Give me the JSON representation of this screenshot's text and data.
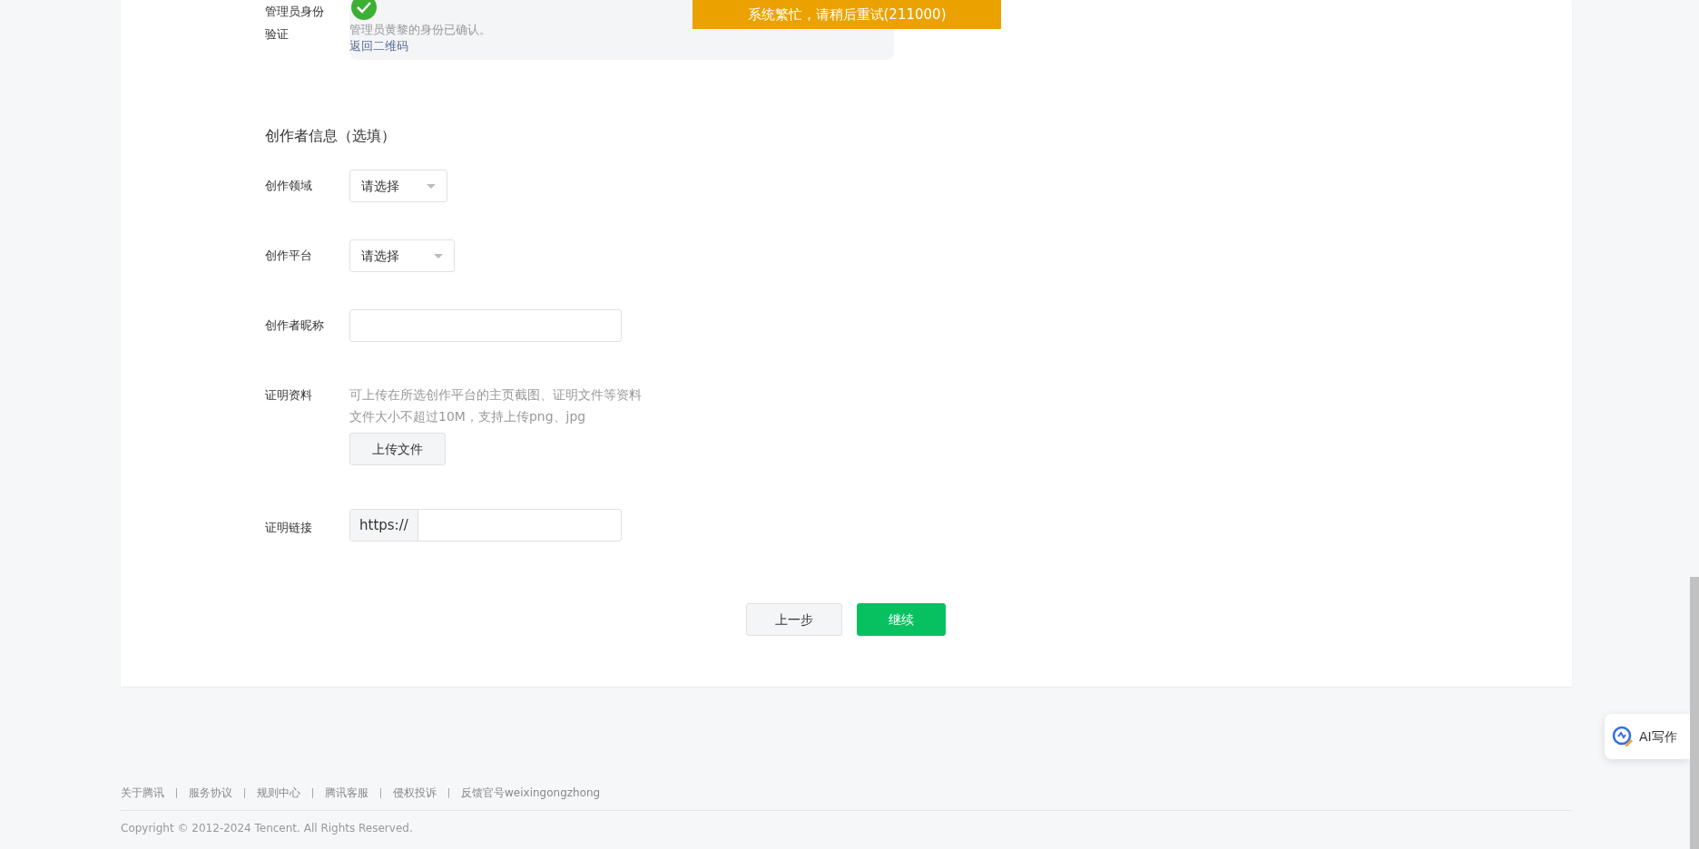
{
  "admin_verify": {
    "label": "管理员身份验证",
    "verified": true,
    "message": "管理员黄黎的身份已确认。",
    "link": "返回二维码"
  },
  "toast": {
    "text": "系统繁忙，请稍后重试(211000)"
  },
  "section_title": "创作者信息（选填）",
  "fields": [
    {
      "kind": "select",
      "label": "创作领域",
      "placeholder": "请选择"
    },
    {
      "kind": "select",
      "label": "创作平台",
      "placeholder": "请选择"
    },
    {
      "kind": "text",
      "label": "创作者昵称"
    },
    {
      "kind": "upload",
      "label": "证明资料",
      "hints": [
        "可上传在所选创作平台的主页截图、证明文件等资料",
        "文件大小不超过10M，支持上传png、jpg"
      ],
      "button": "上传文件"
    },
    {
      "kind": "url",
      "label": "证明链接",
      "prefix": "https://"
    }
  ],
  "buttons": [
    {
      "label": "上一步",
      "kind": "secondary"
    },
    {
      "label": "继续",
      "kind": "primary"
    }
  ],
  "footer": {
    "links": [
      "关于腾讯",
      "服务协议",
      "规则中心",
      "腾讯客服",
      "侵权投诉",
      "反馈官号weixingongzhong"
    ],
    "copyright": "Copyright © 2012-2024 Tencent. All Rights Reserved."
  },
  "ai_button": {
    "label": "AI写作"
  }
}
